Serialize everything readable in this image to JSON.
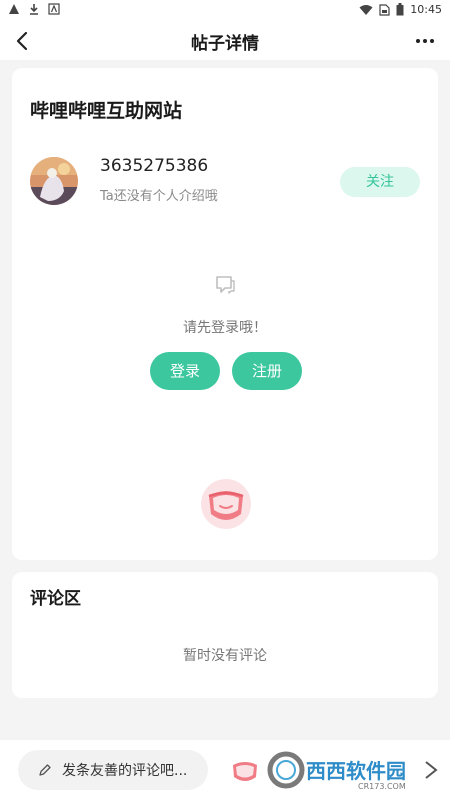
{
  "status_bar": {
    "time": "10:45"
  },
  "app_bar": {
    "title": "帖子详情"
  },
  "post": {
    "title": "哔哩哔哩互助网站",
    "author": {
      "username": "3635275386",
      "bio": "Ta还没有个人介绍哦",
      "follow_label": "关注"
    },
    "login_prompt": "请先登录哦！",
    "login_label": "登录",
    "register_label": "注册"
  },
  "comments": {
    "title": "评论区",
    "empty_text": "暂时没有评论"
  },
  "bottom_bar": {
    "comment_placeholder": "发条友善的评论吧...",
    "watermark_text": "西西软件园",
    "watermark_sub": "CR173.COM"
  },
  "colors": {
    "accent": "#3cc79e",
    "follow_bg": "#dbf7ee",
    "follow_text": "#33c49a",
    "mascot": "#f07c86"
  },
  "icons": [
    "warning-icon",
    "download-icon",
    "font-icon",
    "wifi-icon",
    "sim-icon",
    "battery-icon",
    "back-arrow-icon",
    "more-icon",
    "chat-bubble-icon",
    "mascot-icon",
    "pencil-icon"
  ]
}
